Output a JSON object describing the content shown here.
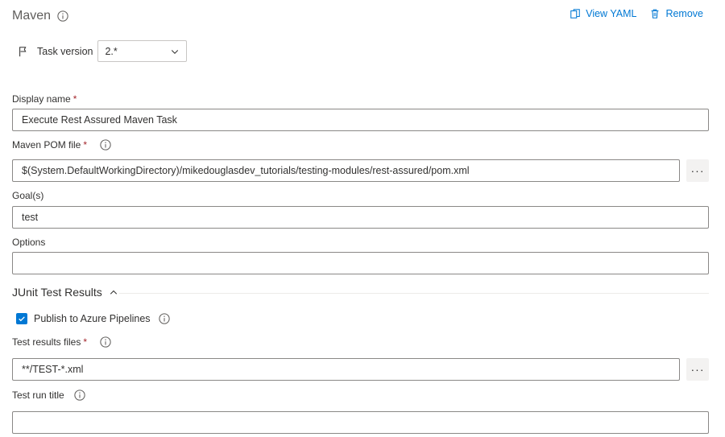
{
  "header": {
    "title": "Maven",
    "view_yaml": "View YAML",
    "remove": "Remove"
  },
  "task_version": {
    "label": "Task version",
    "value": "2.*"
  },
  "fields": {
    "display_name": {
      "label": "Display name",
      "required": "*",
      "value": "Execute Rest Assured Maven Task"
    },
    "pom_file": {
      "label": "Maven POM file",
      "required": "*",
      "value": "$(System.DefaultWorkingDirectory)/mikedouglasdev_tutorials/testing-modules/rest-assured/pom.xml"
    },
    "goals": {
      "label": "Goal(s)",
      "value": "test"
    },
    "options": {
      "label": "Options",
      "value": ""
    }
  },
  "junit": {
    "section_title": "JUnit Test Results",
    "publish_label": "Publish to Azure Pipelines",
    "publish_checked": true,
    "test_results_files": {
      "label": "Test results files",
      "required": "*",
      "value": "**/TEST-*.xml"
    },
    "test_run_title": {
      "label": "Test run title",
      "value": ""
    }
  },
  "ellipsis": "···",
  "colors": {
    "accent": "#0078d4",
    "required": "#a4262c",
    "border": "#8a8886"
  },
  "icons": [
    "info-icon",
    "view-yaml-icon",
    "trash-icon",
    "flag-icon",
    "chevron-down-icon",
    "chevron-up-icon",
    "checkmark-icon"
  ]
}
